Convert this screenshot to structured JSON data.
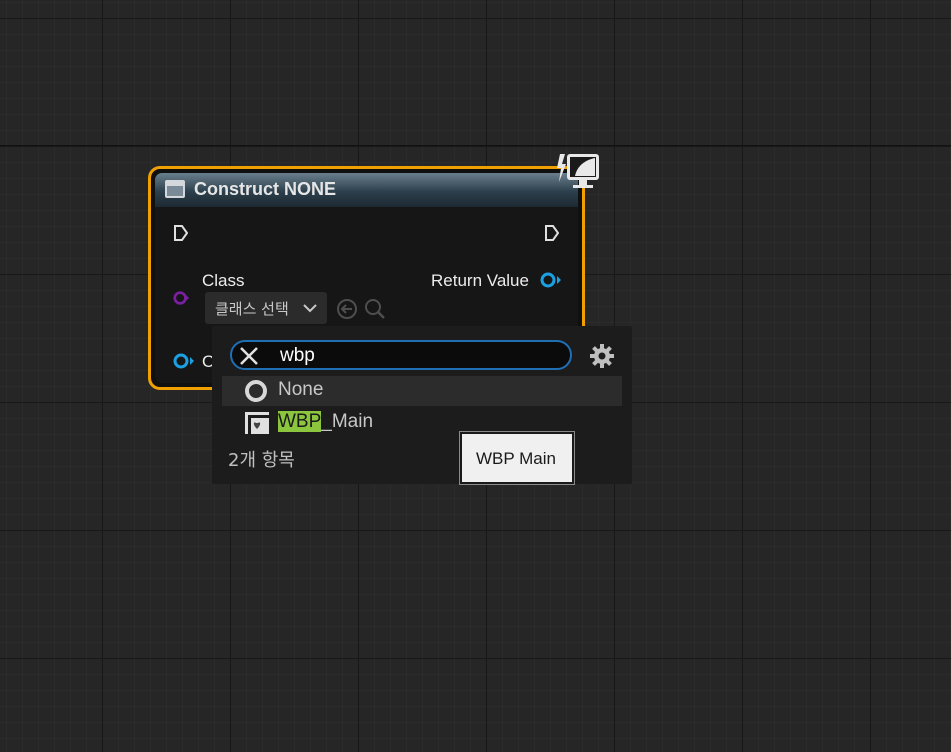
{
  "node": {
    "title": "Construct NONE",
    "header_icon": "widget-blueprint-icon",
    "pins": {
      "class_label": "Class",
      "return_label": "Return Value",
      "owner_label_partial": "O"
    },
    "class_select": {
      "label": "클래스 선택",
      "icons": [
        "chevron-down-icon",
        "use-selected-arrow-icon",
        "browse-search-icon"
      ]
    },
    "corner_icon": "client-only-monitor-icon",
    "colors": {
      "border": "#f0a000",
      "exec_pin": "#e0e0e0",
      "class_pin": "#7b1fa2",
      "object_pin": "#1ba0e2"
    }
  },
  "class_picker": {
    "search_value": "wbp",
    "items": [
      {
        "label": "None",
        "icon": "none-circle-icon",
        "selected": true
      },
      {
        "label_highlight": "WBP",
        "label_rest": "_Main",
        "icon": "widget-blueprint-class-icon",
        "selected": false
      }
    ],
    "count_text": "2개 항목",
    "settings_icon": "gear-icon",
    "clear_icon": "close-icon",
    "highlight_color": "#8cc63f"
  },
  "tooltip": {
    "text": "WBP Main"
  }
}
